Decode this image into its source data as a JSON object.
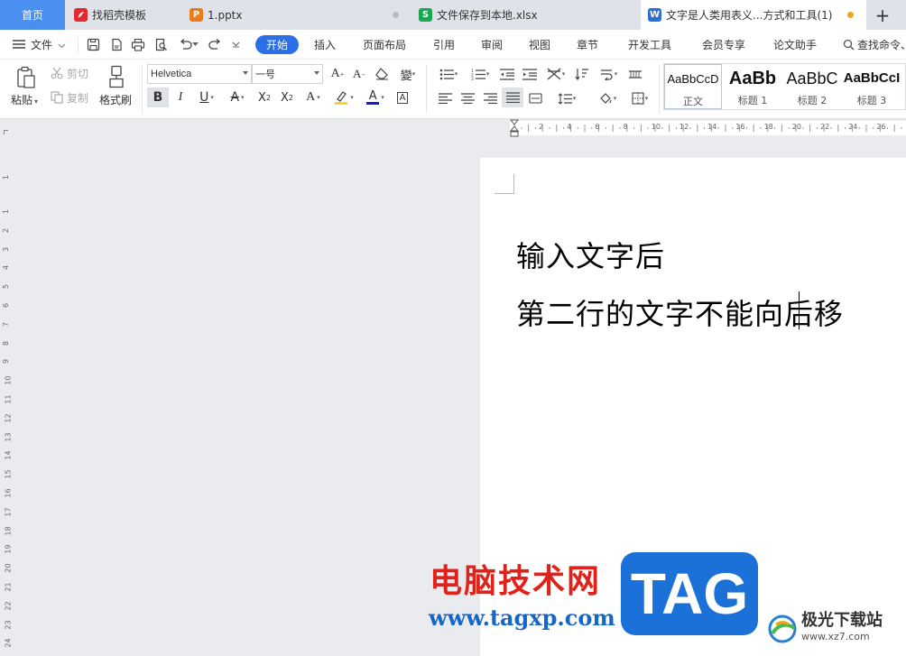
{
  "tabs": [
    {
      "label": "首页"
    },
    {
      "label": "找稻壳模板",
      "icon_text": "",
      "icon_color": "#e5282f"
    },
    {
      "label": "1.pptx",
      "icon_text": "P",
      "icon_color": "#ea7b1c"
    },
    {
      "label": "文件保存到本地.xlsx",
      "icon_text": "S",
      "icon_color": "#1aa74d"
    },
    {
      "label": "文字是人类用表义...方式和工具(1)",
      "icon_text": "W",
      "icon_color": "#2a6fd6"
    }
  ],
  "new_tab_label": "+",
  "menu": {
    "file_label": "文件",
    "items": [
      "开始",
      "插入",
      "页面布局",
      "引用",
      "审阅",
      "视图",
      "章节",
      "开发工具",
      "会员专享",
      "论文助手"
    ],
    "search_label": "查找命令、"
  },
  "ribbon": {
    "paste_label": "粘贴",
    "cut_label": "剪切",
    "copy_label": "复制",
    "format_painter_label": "格式刷",
    "font_name": "Helvetica",
    "font_size": "一号",
    "styles": [
      {
        "preview": "AaBbCcD",
        "name": "正文"
      },
      {
        "preview": "AaBb",
        "name": "标题 1"
      },
      {
        "preview": "AaBbC",
        "name": "标题 2"
      },
      {
        "preview": "AaBbCcI",
        "name": "标题 3"
      }
    ]
  },
  "ruler": {
    "horizontal_ticks": [
      "2",
      "4",
      "6",
      "8",
      "10",
      "12",
      "14",
      "16",
      "18",
      "20",
      "22",
      "24",
      "26",
      "28",
      "30"
    ],
    "vertical_ticks": [
      "1",
      "1",
      "2",
      "3",
      "4",
      "5",
      "6",
      "7",
      "8",
      "9",
      "10",
      "11",
      "12",
      "13",
      "14",
      "15",
      "16",
      "17",
      "18",
      "19",
      "20",
      "21",
      "22",
      "23",
      "24"
    ]
  },
  "document": {
    "line1": "输入文字后",
    "line2": "第二行的文字不能向后移"
  },
  "watermark": {
    "site_name": "电脑技术网",
    "url": "www.tagxp.com",
    "tag": "TAG",
    "corner_text": "极光下载站",
    "corner_url": "www.xz7.com"
  },
  "colors": {
    "accent": "#2b6fe6",
    "active_tab_bg": "#4a8ef0"
  }
}
